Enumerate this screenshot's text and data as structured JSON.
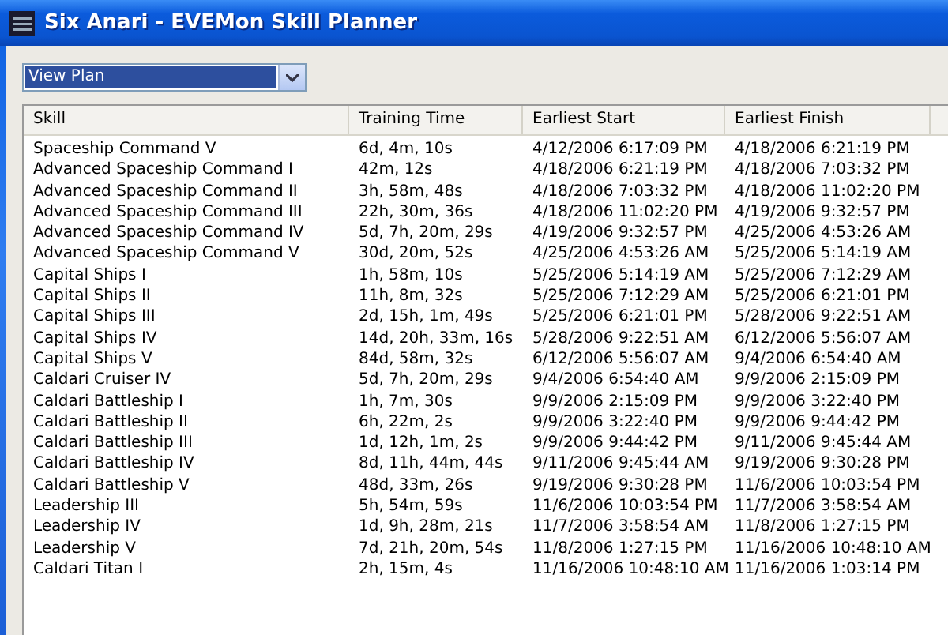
{
  "window": {
    "title": "Six Anari - EVEMon Skill Planner"
  },
  "view_select": {
    "value": "View Plan"
  },
  "table": {
    "columns": [
      "Skill",
      "Training Time",
      "Earliest Start",
      "Earliest Finish"
    ],
    "rows": [
      [
        "Spaceship Command V",
        "6d, 4m, 10s",
        "4/12/2006 6:17:09 PM",
        "4/18/2006 6:21:19 PM"
      ],
      [
        "Advanced Spaceship Command I",
        "42m, 12s",
        "4/18/2006 6:21:19 PM",
        "4/18/2006 7:03:32 PM"
      ],
      [
        "Advanced Spaceship Command II",
        "3h, 58m, 48s",
        "4/18/2006 7:03:32 PM",
        "4/18/2006 11:02:20 PM"
      ],
      [
        "Advanced Spaceship Command III",
        "22h, 30m, 36s",
        "4/18/2006 11:02:20 PM",
        "4/19/2006 9:32:57 PM"
      ],
      [
        "Advanced Spaceship Command IV",
        "5d, 7h, 20m, 29s",
        "4/19/2006 9:32:57 PM",
        "4/25/2006 4:53:26 AM"
      ],
      [
        "Advanced Spaceship Command V",
        "30d, 20m, 52s",
        "4/25/2006 4:53:26 AM",
        "5/25/2006 5:14:19 AM"
      ],
      [
        "Capital Ships I",
        "1h, 58m, 10s",
        "5/25/2006 5:14:19 AM",
        "5/25/2006 7:12:29 AM"
      ],
      [
        "Capital Ships II",
        "11h, 8m, 32s",
        "5/25/2006 7:12:29 AM",
        "5/25/2006 6:21:01 PM"
      ],
      [
        "Capital Ships III",
        "2d, 15h, 1m, 49s",
        "5/25/2006 6:21:01 PM",
        "5/28/2006 9:22:51 AM"
      ],
      [
        "Capital Ships IV",
        "14d, 20h, 33m, 16s",
        "5/28/2006 9:22:51 AM",
        "6/12/2006 5:56:07 AM"
      ],
      [
        "Capital Ships V",
        "84d, 58m, 32s",
        "6/12/2006 5:56:07 AM",
        "9/4/2006 6:54:40 AM"
      ],
      [
        "Caldari Cruiser IV",
        "5d, 7h, 20m, 29s",
        "9/4/2006 6:54:40 AM",
        "9/9/2006 2:15:09 PM"
      ],
      [
        "Caldari Battleship I",
        "1h, 7m, 30s",
        "9/9/2006 2:15:09 PM",
        "9/9/2006 3:22:40 PM"
      ],
      [
        "Caldari Battleship II",
        "6h, 22m, 2s",
        "9/9/2006 3:22:40 PM",
        "9/9/2006 9:44:42 PM"
      ],
      [
        "Caldari Battleship III",
        "1d, 12h, 1m, 2s",
        "9/9/2006 9:44:42 PM",
        "9/11/2006 9:45:44 AM"
      ],
      [
        "Caldari Battleship IV",
        "8d, 11h, 44m, 44s",
        "9/11/2006 9:45:44 AM",
        "9/19/2006 9:30:28 PM"
      ],
      [
        "Caldari Battleship V",
        "48d, 33m, 26s",
        "9/19/2006 9:30:28 PM",
        "11/6/2006 10:03:54 PM"
      ],
      [
        "Leadership III",
        "5h, 54m, 59s",
        "11/6/2006 10:03:54 PM",
        "11/7/2006 3:58:54 AM"
      ],
      [
        "Leadership IV",
        "1d, 9h, 28m, 21s",
        "11/7/2006 3:58:54 AM",
        "11/8/2006 1:27:15 PM"
      ],
      [
        "Leadership V",
        "7d, 21h, 20m, 54s",
        "11/8/2006 1:27:15 PM",
        "11/16/2006 10:48:10 AM"
      ],
      [
        "Caldari Titan I",
        "2h, 15m, 4s",
        "11/16/2006 10:48:10 AM",
        "11/16/2006 1:03:14 PM"
      ]
    ]
  }
}
